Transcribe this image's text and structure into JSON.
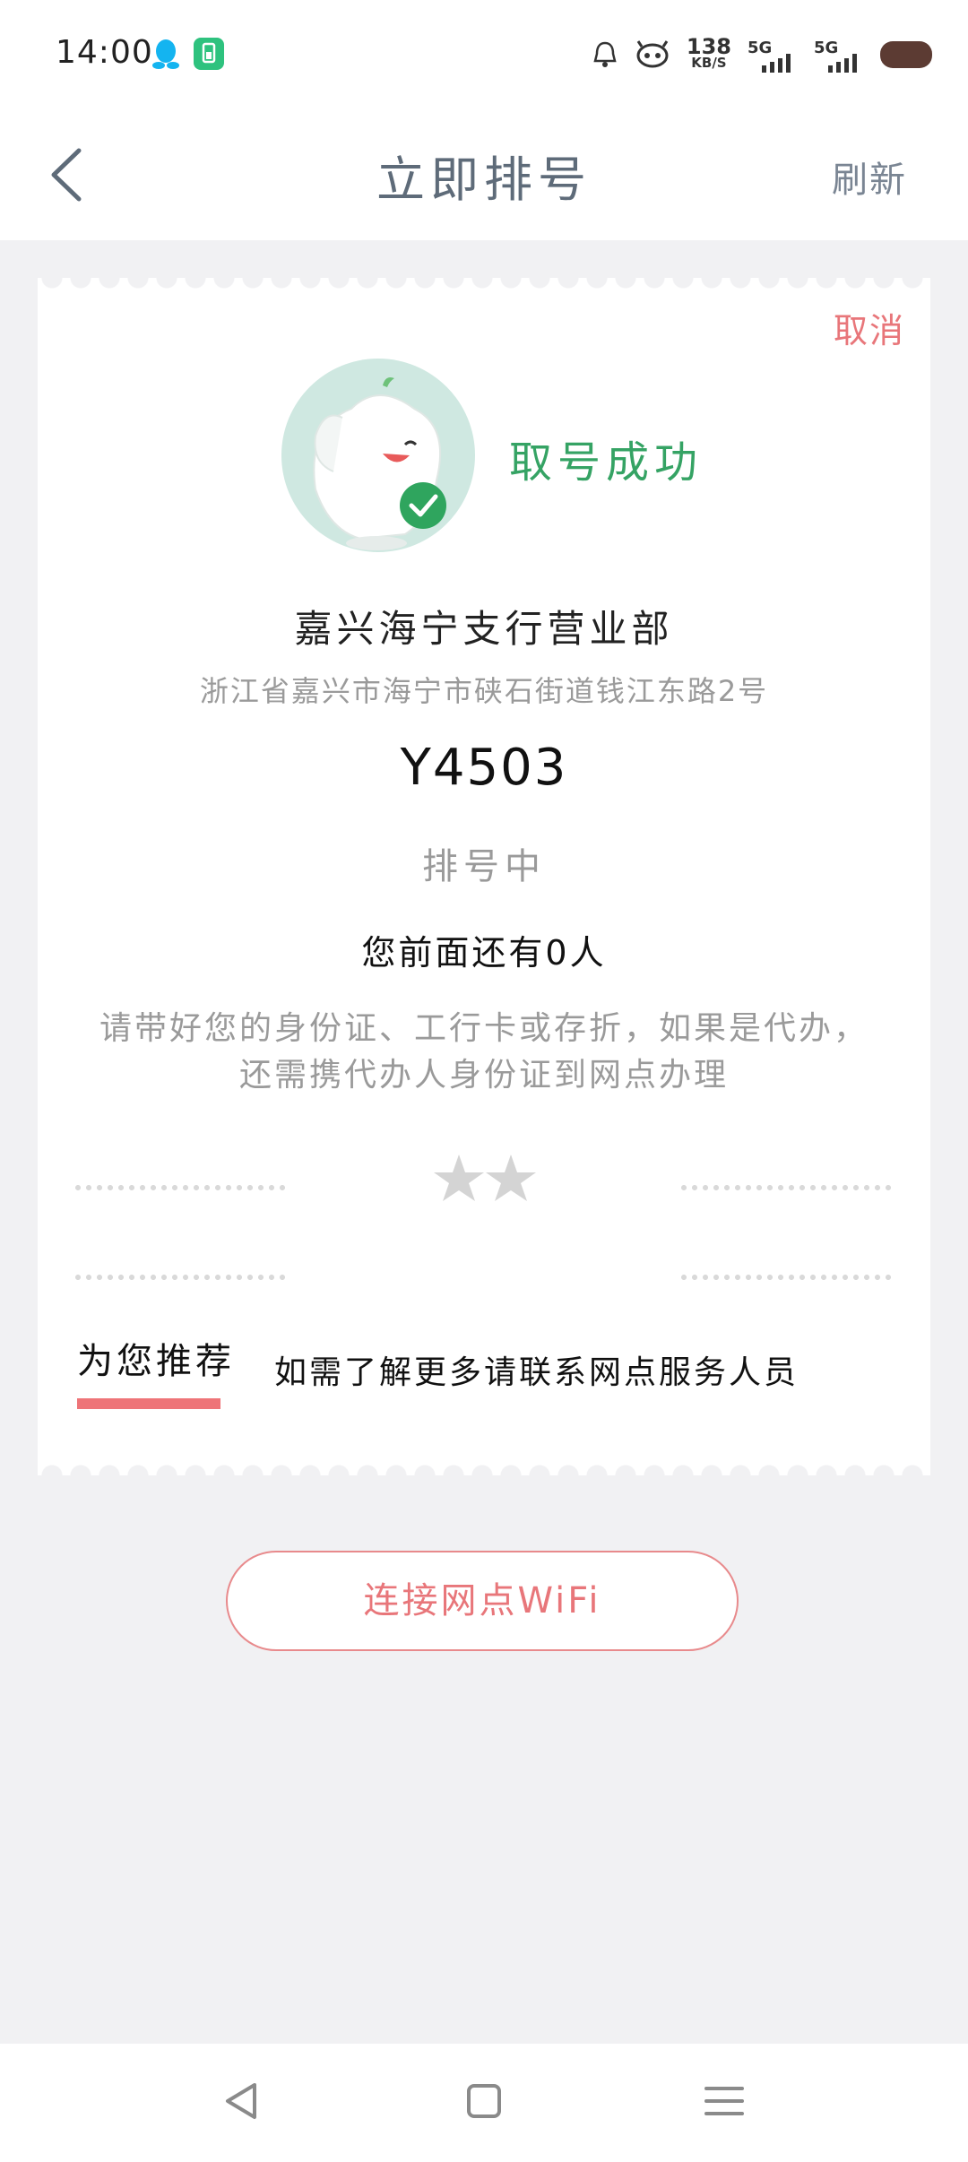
{
  "status_bar": {
    "time": "14:00",
    "net_speed_value": "138",
    "net_speed_unit": "KB/S",
    "sim1_label": "5G",
    "sim2_label": "5G"
  },
  "header": {
    "title": "立即排号",
    "refresh_label": "刷新"
  },
  "ticket": {
    "cancel_label": "取消",
    "success_text": "取号成功",
    "branch_name": "嘉兴海宁支行营业部",
    "branch_address": "浙江省嘉兴市海宁市硖石街道钱江东路2号",
    "ticket_number": "Y4503",
    "queue_status": "排号中",
    "people_ahead": "您前面还有0人",
    "notice_line1": "请带好您的身份证、工行卡或存折，如果是代办，",
    "notice_line2": "还需携代办人身份证到网点办理",
    "recommend_tab": "为您推荐",
    "recommend_content": "如需了解更多请联系网点服务人员"
  },
  "wifi_button_label": "连接网点WiFi",
  "colors": {
    "accent_red": "#e8767a",
    "success_green": "#35a364",
    "title_gray": "#5e6b79",
    "background": "#f1f1f3"
  }
}
